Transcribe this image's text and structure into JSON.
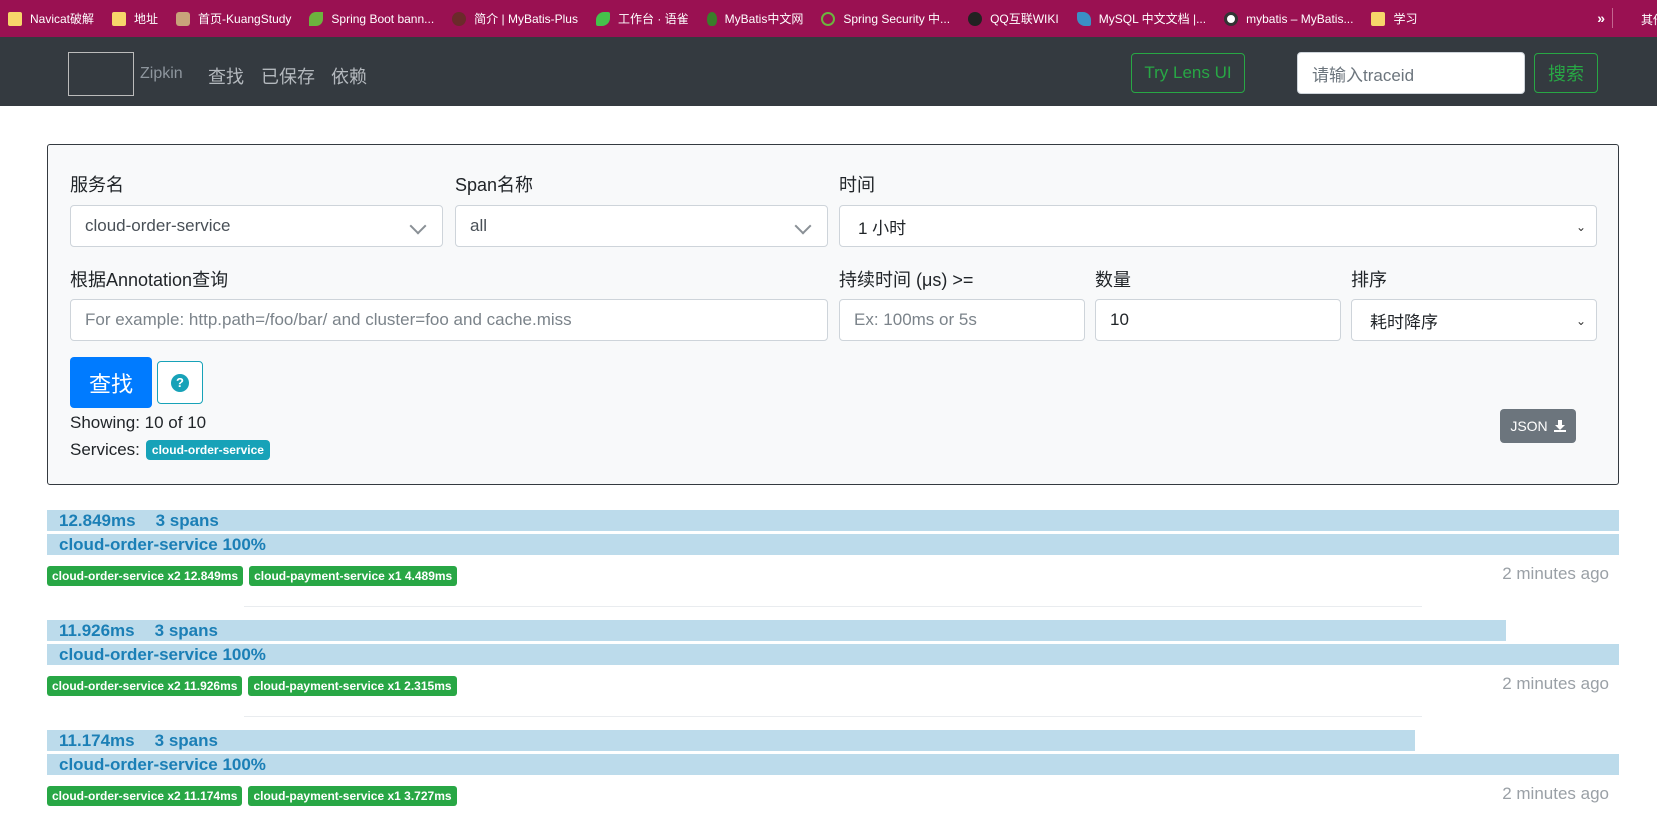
{
  "bookmarks": [
    {
      "label": "Navicat破解",
      "icon": "folder-icon"
    },
    {
      "label": "地址",
      "icon": "folder-icon"
    },
    {
      "label": "首页-KuangStudy",
      "icon": "avatar-icon"
    },
    {
      "label": "Spring Boot bann...",
      "icon": "leaf-icon"
    },
    {
      "label": "简介 | MyBatis-Plus",
      "icon": "bird-icon"
    },
    {
      "label": "工作台 · 语雀",
      "icon": "yuque-icon"
    },
    {
      "label": "MyBatis中文网",
      "icon": "mongo-leaf-icon"
    },
    {
      "label": "Spring Security 中...",
      "icon": "spring-icon"
    },
    {
      "label": "QQ互联WIKI",
      "icon": "qq-icon"
    },
    {
      "label": "MySQL 中文文档 |...",
      "icon": "mysql-icon"
    },
    {
      "label": "mybatis – MyBatis...",
      "icon": "globe-icon"
    },
    {
      "label": "学习",
      "icon": "folder-icon"
    }
  ],
  "bookmarks_more": "»",
  "bookmarks_other": "其他书",
  "nav": {
    "brand": "Zipkin",
    "links": [
      "查找",
      "已保存",
      "依赖"
    ],
    "lens_button": "Try Lens UI",
    "traceid_placeholder": "请输入traceid",
    "search_button": "搜索"
  },
  "form": {
    "service_label": "服务名",
    "service_value": "cloud-order-service",
    "span_label": "Span名称",
    "span_value": "all",
    "time_label": "时间",
    "time_value": "1 小时",
    "annotation_label": "根据Annotation查询",
    "annotation_placeholder": "For example: http.path=/foo/bar/ and cluster=foo and cache.miss",
    "duration_label": "持续时间 (μs) >=",
    "duration_placeholder": "Ex: 100ms or 5s",
    "limit_label": "数量",
    "limit_value": "10",
    "sort_label": "排序",
    "sort_value": "耗时降序",
    "find_button": "查找",
    "help_glyph": "?",
    "showing": "Showing: 10 of 10",
    "services_label": "Services:",
    "services_badge": "cloud-order-service",
    "json_button": "JSON"
  },
  "traces": [
    {
      "duration": "12.849ms",
      "spans": "3 spans",
      "service_line": "cloud-order-service 100%",
      "width_fraction": 1.0,
      "tags": [
        "cloud-order-service x2 12.849ms",
        "cloud-payment-service x1 4.489ms"
      ],
      "ago": "2 minutes ago"
    },
    {
      "duration": "11.926ms",
      "spans": "3 spans",
      "service_line": "cloud-order-service 100%",
      "width_fraction": 0.928,
      "tags": [
        "cloud-order-service x2 11.926ms",
        "cloud-payment-service x1 2.315ms"
      ],
      "ago": "2 minutes ago"
    },
    {
      "duration": "11.174ms",
      "spans": "3 spans",
      "service_line": "cloud-order-service 100%",
      "width_fraction": 0.87,
      "tags": [
        "cloud-order-service x2 11.174ms",
        "cloud-payment-service x1 3.727ms"
      ],
      "ago": "2 minutes ago"
    }
  ],
  "colors": {
    "bookmarks_bg": "#9a1152",
    "navbar_bg": "#343a40",
    "primary": "#007bff",
    "success": "#28a745",
    "info": "#17a2b8",
    "trace_bar": "#bcdbeb",
    "trace_text": "#1b7fb6"
  }
}
